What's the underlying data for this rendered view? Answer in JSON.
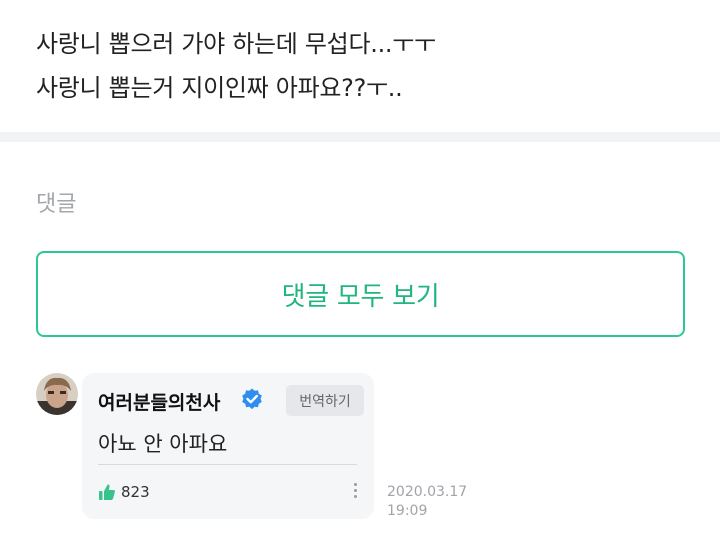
{
  "post": {
    "line1": "사랑니 뽑으러 가야 하는데 무섭다...ㅜㅜ",
    "line2": "사랑니 뽑는거 지이인짜 아파요??ㅜ.."
  },
  "comments": {
    "heading": "댓글",
    "view_all_label": "댓글 모두 보기",
    "items": [
      {
        "author": "여러분들의천사",
        "verified_icon": "verified-badge-icon",
        "translate_label": "번역하기",
        "text": "아뇨 안 아파요",
        "like_icon": "thumbs-up-icon",
        "like_count": "823",
        "date": "2020.03.17",
        "time": "19:09"
      }
    ]
  },
  "colors": {
    "accent": "#21b57f",
    "accent_border": "#2ec792",
    "verified": "#2f8ef0",
    "like": "#37c48c"
  }
}
